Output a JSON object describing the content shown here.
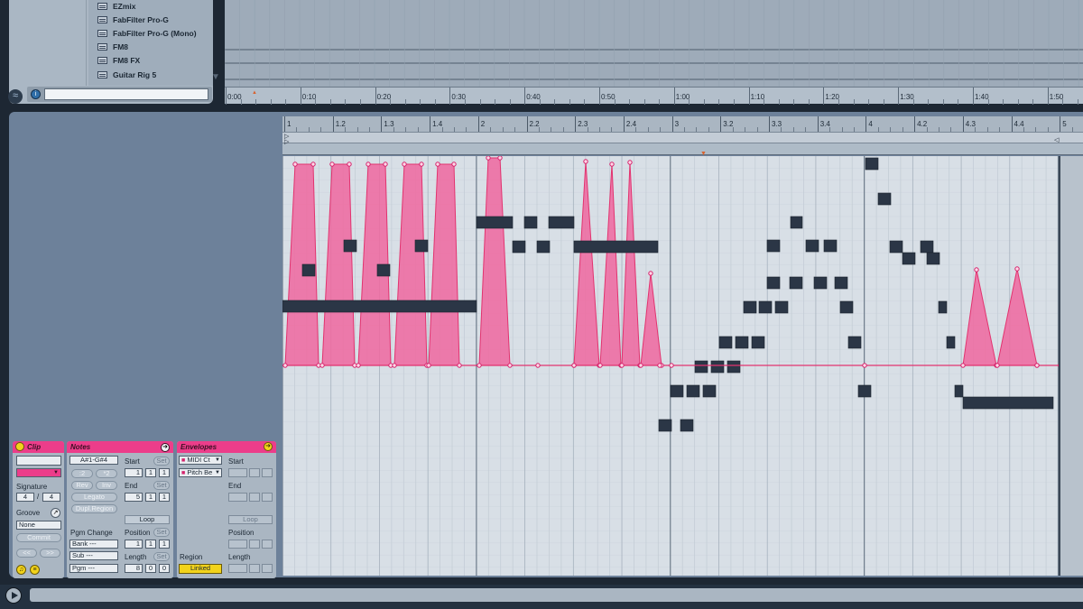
{
  "browser": {
    "plugins": [
      "EZmix",
      "FabFilter Pro-G",
      "FabFilter Pro-G (Mono)",
      "FM8",
      "FM8 FX",
      "Guitar Rig 5"
    ],
    "search_value": ""
  },
  "arrangement": {
    "time_labels": [
      "0:00",
      "0:10",
      "0:20",
      "0:30",
      "0:40",
      "0:50",
      "1:00",
      "1:10",
      "1:20",
      "1:30",
      "1:40",
      "1:50"
    ]
  },
  "clip_ruler": {
    "labels": [
      "1",
      "1.2",
      "1.3",
      "1.4",
      "2",
      "2.2",
      "2.3",
      "2.4",
      "3",
      "3.2",
      "3.3",
      "3.4",
      "4",
      "4.2",
      "4.3",
      "4.4",
      "5"
    ]
  },
  "clip_panel": {
    "title": "Clip",
    "signature_label": "Signature",
    "sig_num": "4",
    "sig_den": "4",
    "groove_label": "Groove",
    "groove_value": "None",
    "commit_label": "Commit",
    "nudge_back": "<<",
    "nudge_fwd": ">>"
  },
  "notes_panel": {
    "title": "Notes",
    "range": "A#1-G#4",
    "halve": ":2",
    "double": "*2",
    "rev": "Rev",
    "inv": "Inv",
    "legato": "Legato",
    "dupl": "Dupl.Region",
    "pgm_change_label": "Pgm Change",
    "bank": "Bank ---",
    "sub": "Sub ---",
    "pgm": "Pgm ---",
    "start_label": "Start",
    "start_vals": [
      "1",
      "1",
      "1"
    ],
    "end_label": "End",
    "end_vals": [
      "5",
      "1",
      "1"
    ],
    "set_label": "Set",
    "loop_label": "Loop",
    "position_label": "Position",
    "position_vals": [
      "1",
      "1",
      "1"
    ],
    "length_label": "Length",
    "length_vals": [
      "8",
      "0",
      "0"
    ]
  },
  "envelopes_panel": {
    "title": "Envelopes",
    "device": "MIDI Ct",
    "control": "Pitch Be",
    "region_label": "Region",
    "linked_label": "Linked",
    "start_label": "Start",
    "end_label": "End",
    "loop_label": "Loop",
    "position_label": "Position",
    "length_label": "Length"
  },
  "colors": {
    "accent": "#ec3d8a",
    "envelope_fill": "#f0679f",
    "note": "#2b3646",
    "yellow": "#f2d31b"
  },
  "piano_roll": {
    "beats_total": 16,
    "notes_rel": [
      [
        0,
        2.3,
        0.2,
        0,
        "pitch"
      ],
      [
        0.8,
        1.55,
        0.3,
        0,
        "pitch"
      ]
    ]
  }
}
